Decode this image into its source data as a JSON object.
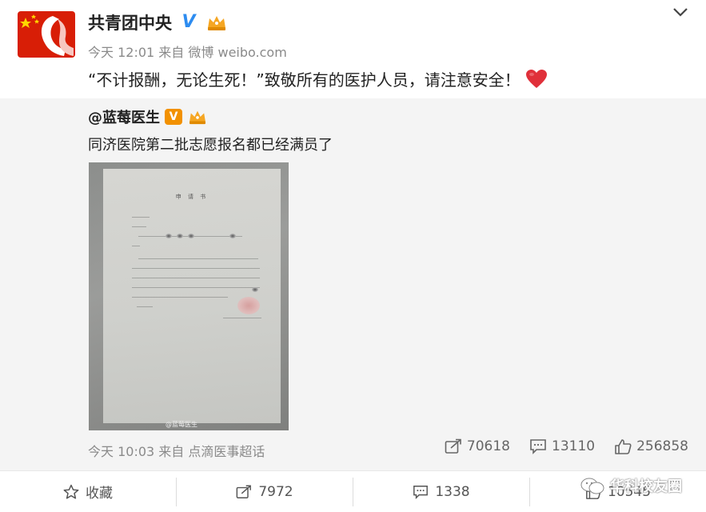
{
  "post": {
    "author": "共青团中央",
    "time": "今天 12:01",
    "source_prefix": "来自",
    "source": "微博 weibo.com",
    "text": "“不计报酬，无论生死！”致敬所有的医护人员，请注意安全！"
  },
  "repost": {
    "author": "@蓝莓医生",
    "text": "同济医院第二批志愿报名都已经满员了",
    "image": {
      "doc_title": "申 请 书",
      "watermark": "@蓝莓医生"
    },
    "time": "今天 10:03",
    "source_prefix": "来自",
    "source": "点滴医事超话",
    "reposts": "70618",
    "comments": "13110",
    "likes": "256858"
  },
  "actions": {
    "favorite": "收藏",
    "repost": "7972",
    "comment": "1338",
    "like": "10545"
  },
  "watermark_text": "华科校友圈",
  "colors": {
    "verify_blue": "#2d8cf0",
    "v_orange": "#f29100",
    "repost_bg": "#f4f4f4",
    "heart_red": "#e0303a"
  }
}
